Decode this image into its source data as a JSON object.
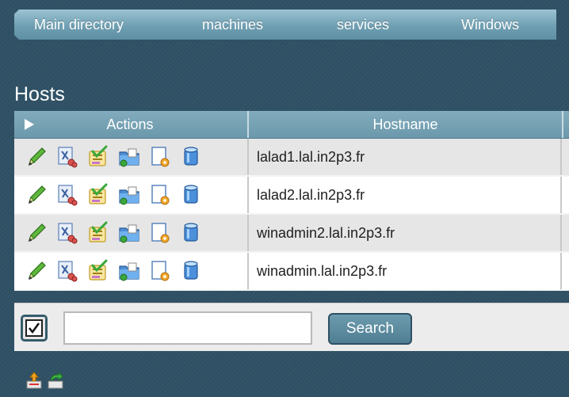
{
  "breadcrumb": [
    {
      "label": "Main directory"
    },
    {
      "label": "machines"
    },
    {
      "label": "services"
    },
    {
      "label": "Windows"
    }
  ],
  "page": {
    "title": "Hosts"
  },
  "table": {
    "columns": {
      "actions": "Actions",
      "hostname": "Hostname"
    },
    "row_actions": [
      "edit-icon",
      "tools-icon",
      "checklist-icon",
      "folder-icon",
      "document-gear-icon",
      "database-icon"
    ],
    "rows": [
      {
        "hostname": "lalad1.lal.in2p3.fr"
      },
      {
        "hostname": "lalad2.lal.in2p3.fr"
      },
      {
        "hostname": "winadmin2.lal.in2p3.fr"
      },
      {
        "hostname": "winadmin.lal.in2p3.fr"
      }
    ]
  },
  "filter": {
    "checkbox_checked": true,
    "input_value": "",
    "search_label": "Search"
  },
  "colors": {
    "background": "#2f5064",
    "header": "#7aa5b6",
    "accent": "#6f9fb2"
  },
  "bottom_toolbar": [
    "import-icon",
    "export-icon"
  ]
}
